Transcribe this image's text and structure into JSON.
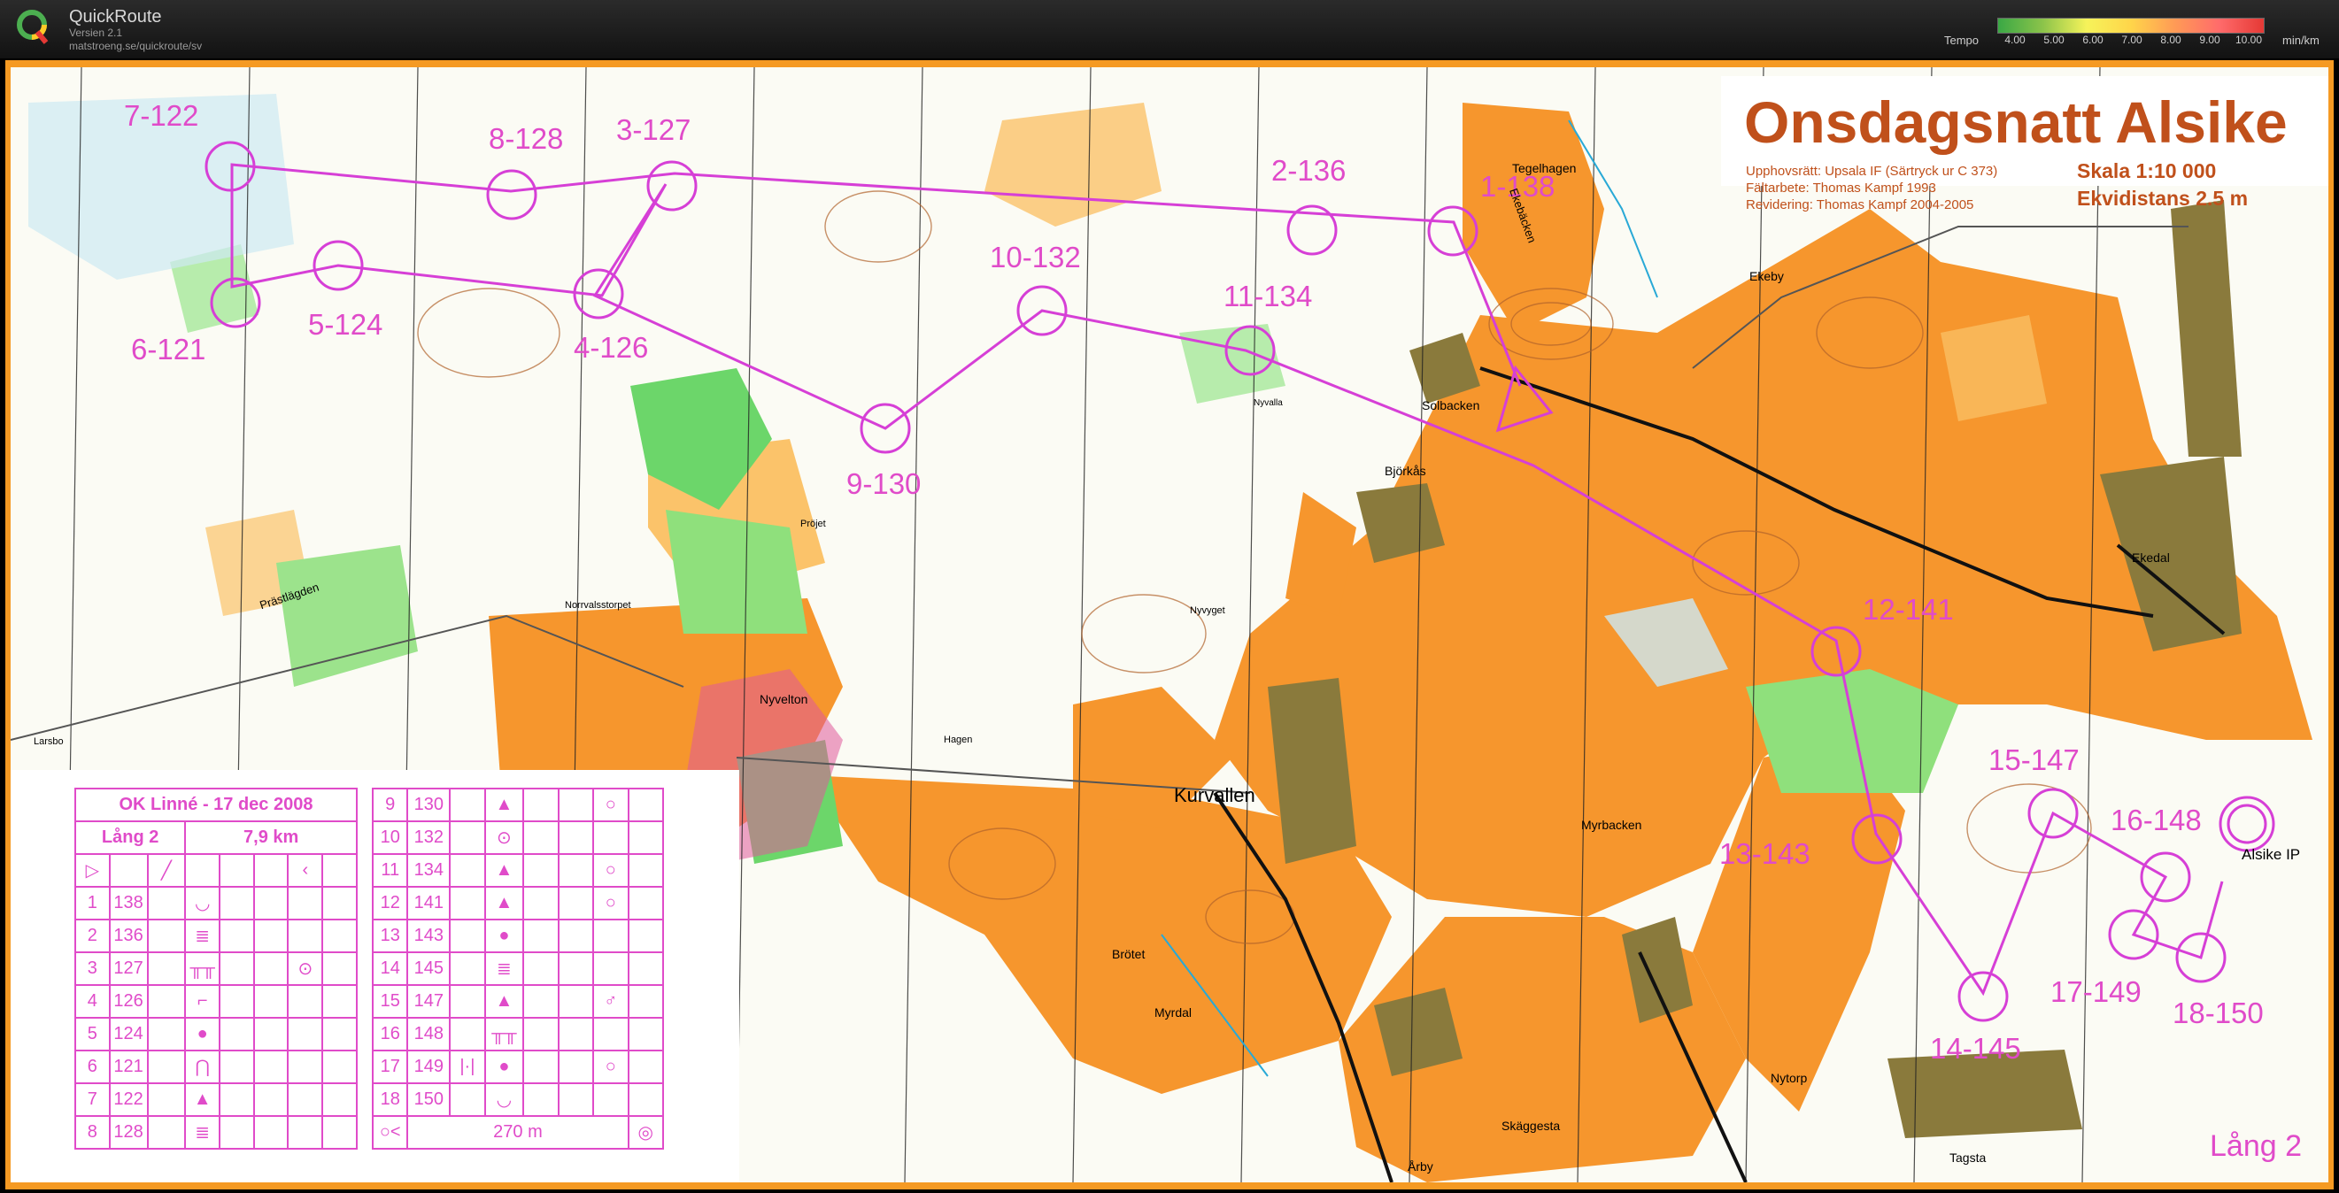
{
  "app": {
    "title": "QuickRoute",
    "version": "Versien 2.1",
    "url": "matstroeng.se/quickroute/sv"
  },
  "tempo": {
    "label": "Tempo",
    "unit": "min/km",
    "ticks": [
      "4.00",
      "5.00",
      "6.00",
      "7.00",
      "8.00",
      "9.00",
      "10.00"
    ]
  },
  "map": {
    "title": "Onsdagsnatt Alsike",
    "credits": [
      "Upphovsrätt: Upsala IF (Särtryck ur C 373)",
      "Fältarbete: Thomas Kampf 1993",
      "Revidering: Thomas Kampf 2004-2005"
    ],
    "scale": "Skala 1:10 000",
    "contour": "Ekvidistans 2.5 m",
    "course_label": "Lång 2",
    "places": [
      "Tegelhagen",
      "Ekeby",
      "Solbacken",
      "Björkås",
      "Nyvalla",
      "Ekedal",
      "Norrvalsstorpet",
      "Nyvelton",
      "Hagen",
      "Kurvallen",
      "Myrbacken",
      "Brötet",
      "Myrdal",
      "Nytorp",
      "Skäggesta",
      "Tagsta",
      "Årby",
      "Larsbo",
      "Alsike IP",
      "Nyvyget",
      "Pröjet",
      "Prästlägden",
      "Ekebäcken"
    ],
    "control_labels": [
      "1-138",
      "2-136",
      "3-127",
      "4-126",
      "5-124",
      "6-121",
      "7-122",
      "8-128",
      "9-130",
      "10-132",
      "11-134",
      "12-141",
      "13-143",
      "14-145",
      "15-147",
      "16-148",
      "17-149",
      "18-150"
    ]
  },
  "control_card": {
    "event": "OK Linné - 17 dec 2008",
    "course": "Lång 2",
    "length": "7,9 km",
    "finish_distance": "270 m",
    "rows": [
      {
        "n": "1",
        "code": "138",
        "c": "",
        "d": "◡",
        "e": "",
        "f": "",
        "g": ""
      },
      {
        "n": "2",
        "code": "136",
        "c": "",
        "d": "≣",
        "e": "",
        "f": "",
        "g": ""
      },
      {
        "n": "3",
        "code": "127",
        "c": "",
        "d": "╥╥",
        "e": "",
        "f": "",
        "g": "⊙"
      },
      {
        "n": "4",
        "code": "126",
        "c": "",
        "d": "⌐",
        "e": "",
        "f": "",
        "g": ""
      },
      {
        "n": "5",
        "code": "124",
        "c": "",
        "d": "●",
        "e": "",
        "f": "",
        "g": ""
      },
      {
        "n": "6",
        "code": "121",
        "c": "",
        "d": "⋂",
        "e": "",
        "f": "",
        "g": ""
      },
      {
        "n": "7",
        "code": "122",
        "c": "",
        "d": "▲",
        "e": "",
        "f": "",
        "g": ""
      },
      {
        "n": "8",
        "code": "128",
        "c": "",
        "d": "≣",
        "e": "",
        "f": "",
        "g": ""
      },
      {
        "n": "9",
        "code": "130",
        "c": "",
        "d": "▲",
        "e": "",
        "f": "",
        "g": "○"
      },
      {
        "n": "10",
        "code": "132",
        "c": "",
        "d": "⊙",
        "e": "",
        "f": "",
        "g": ""
      },
      {
        "n": "11",
        "code": "134",
        "c": "",
        "d": "▲",
        "e": "",
        "f": "",
        "g": "○"
      },
      {
        "n": "12",
        "code": "141",
        "c": "",
        "d": "▲",
        "e": "",
        "f": "",
        "g": "○"
      },
      {
        "n": "13",
        "code": "143",
        "c": "",
        "d": "●",
        "e": "",
        "f": "",
        "g": ""
      },
      {
        "n": "14",
        "code": "145",
        "c": "",
        "d": "≣",
        "e": "",
        "f": "",
        "g": ""
      },
      {
        "n": "15",
        "code": "147",
        "c": "",
        "d": "▲",
        "e": "",
        "f": "",
        "g": "♂"
      },
      {
        "n": "16",
        "code": "148",
        "c": "",
        "d": "╥╥",
        "e": "",
        "f": "",
        "g": ""
      },
      {
        "n": "17",
        "code": "149",
        "c": "|·|",
        "d": "●",
        "e": "",
        "f": "",
        "g": "○"
      },
      {
        "n": "18",
        "code": "150",
        "c": "",
        "d": "◡",
        "e": "",
        "f": "",
        "g": ""
      }
    ]
  }
}
